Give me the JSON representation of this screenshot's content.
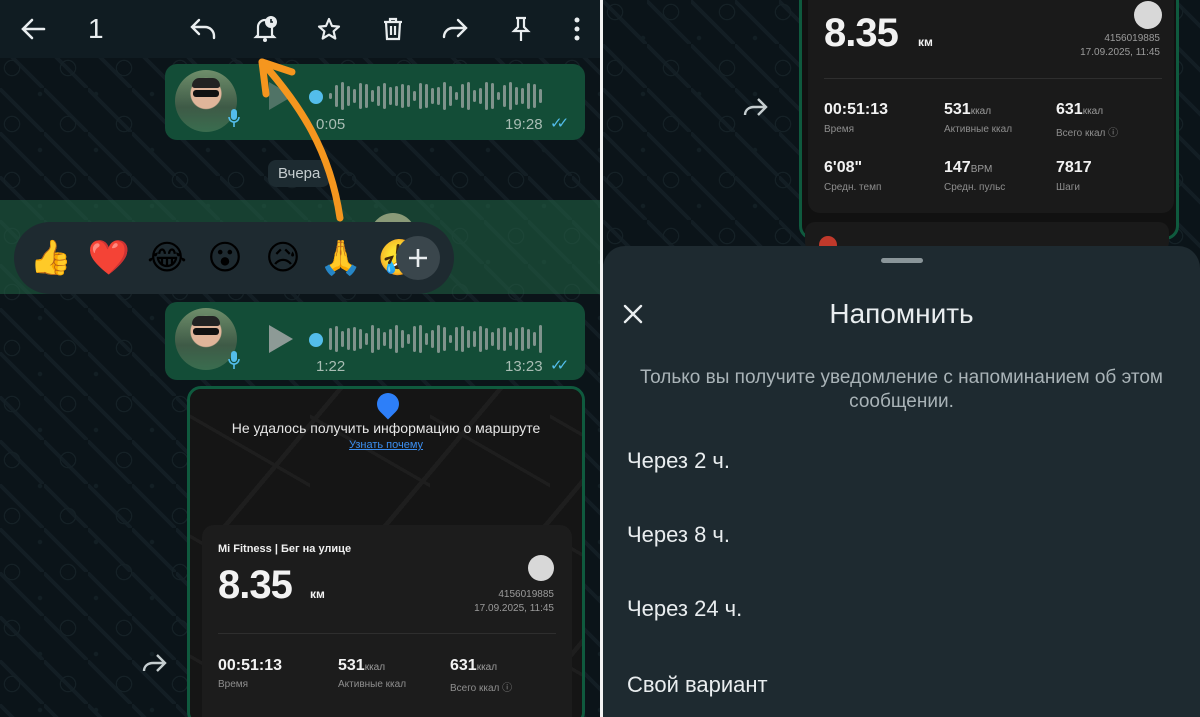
{
  "left": {
    "actionbar": {
      "selected_count": "1",
      "icons": [
        "back-arrow-icon",
        "reply-icon",
        "reminder-bell-icon",
        "star-icon",
        "delete-icon",
        "forward-icon",
        "pin-icon",
        "more-icon"
      ]
    },
    "voice_messages": [
      {
        "duration": "0:05",
        "time": "19:28"
      },
      {
        "duration": "1:22",
        "time": "13:23"
      }
    ],
    "date_chip": "Вчера",
    "reactions": [
      "👍",
      "❤️",
      "😂",
      "😮",
      "😥",
      "🙏",
      "🤣"
    ],
    "map_card": {
      "route_message": "Не удалось получить информацию о маршруте",
      "route_link": "Узнать почему"
    },
    "fitness": {
      "title": "Mi Fitness | Бег на улице",
      "distance": "8.35",
      "unit": "км",
      "id": "4156019885",
      "date": "17.09.2025, 11:45",
      "stats": [
        {
          "value": "00:51:13",
          "suffix": "",
          "label": "Время"
        },
        {
          "value": "531",
          "suffix": "ккал",
          "label": "Активные ккал"
        },
        {
          "value": "631",
          "suffix": "ккал",
          "label": "Всего ккал ⓘ"
        }
      ]
    }
  },
  "right": {
    "fitness": {
      "distance": "8.35",
      "unit": "км",
      "id": "4156019885",
      "date": "17.09.2025, 11:45",
      "stats": [
        {
          "value": "00:51:13",
          "suffix": "",
          "label": "Время"
        },
        {
          "value": "531",
          "suffix": "ккал",
          "label": "Активные ккал"
        },
        {
          "value": "631",
          "suffix": "ккал",
          "label": "Всего ккал ⓘ"
        },
        {
          "value": "6'08\"",
          "suffix": "",
          "label": "Средн. темп"
        },
        {
          "value": "147",
          "suffix": "BPM",
          "label": "Средн. пульс"
        },
        {
          "value": "7817",
          "suffix": "",
          "label": "Шаги"
        }
      ]
    },
    "sheet": {
      "title": "Напомнить",
      "description": "Только вы получите уведомление с напоминанием об этом сообщении.",
      "options": [
        "Через 2 ч.",
        "Через 8 ч.",
        "Через 24 ч.",
        "Свой вариант"
      ]
    }
  },
  "colors": {
    "bubble": "#134d37",
    "accent_blue": "#53bdeb",
    "arrow_orange": "#f5961e",
    "sheet_bg": "#1e2a30"
  }
}
